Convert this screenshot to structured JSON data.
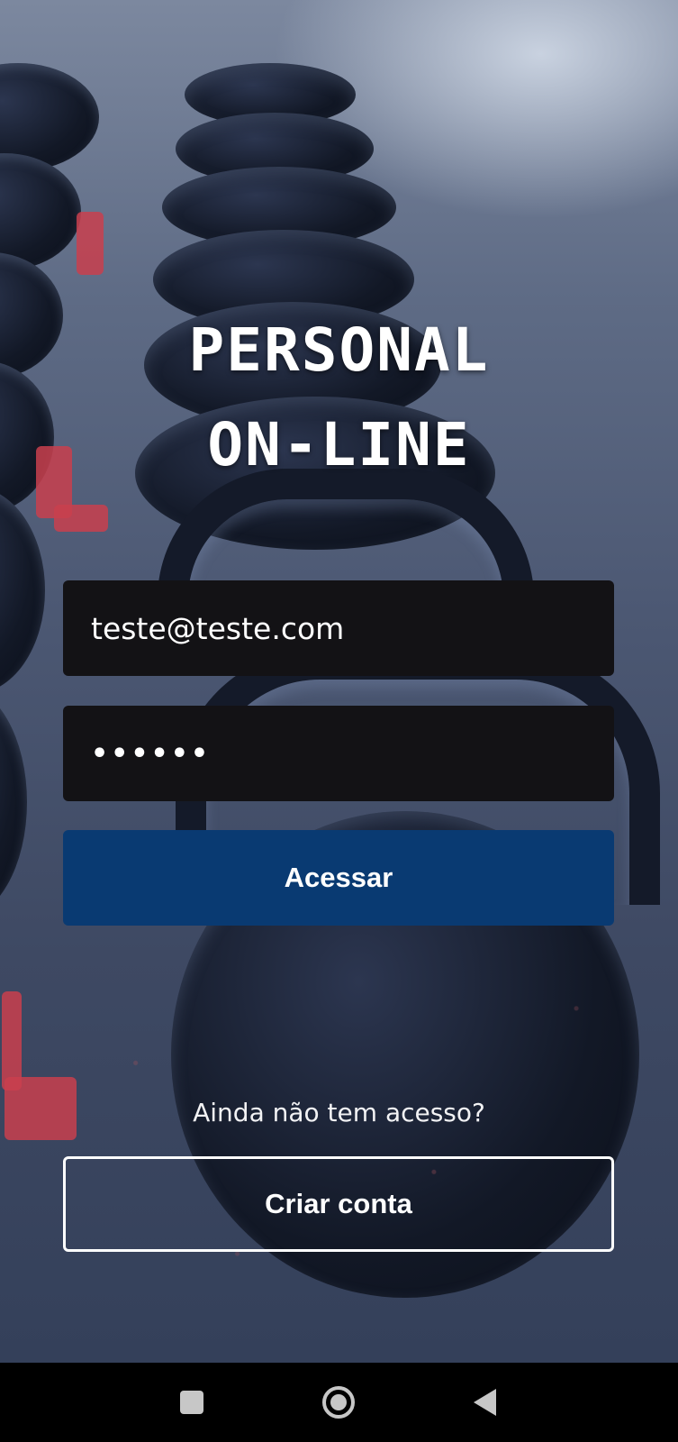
{
  "app": {
    "title_line1": "PERSONAL",
    "title_line2": "ON-LINE"
  },
  "login": {
    "email_value": "teste@teste.com",
    "password_value": "••••••",
    "submit_label": "Acessar"
  },
  "signup": {
    "prompt": "Ainda não tem acesso?",
    "button_label": "Criar conta"
  },
  "navbar": {
    "recents_icon": "square-icon",
    "home_icon": "circle-icon",
    "back_icon": "triangle-back-icon"
  },
  "colors": {
    "primary_button": "#093a72",
    "input_background": "#131215",
    "text": "#ffffff"
  }
}
